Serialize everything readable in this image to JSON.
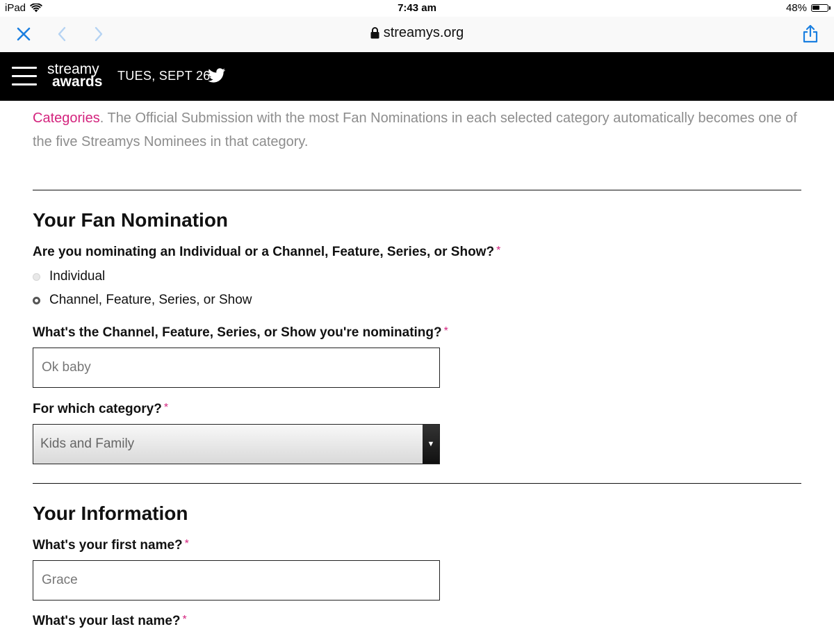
{
  "status_bar": {
    "device": "iPad",
    "time": "7:43 am",
    "battery": "48%",
    "battery_level": 0.48
  },
  "browser": {
    "url": "streamys.org",
    "icons": [
      "close-icon",
      "back-icon",
      "forward-icon",
      "lock-icon",
      "share-icon"
    ]
  },
  "site_header": {
    "logo_top": "streamy",
    "logo_bottom": "awards",
    "date": "TUES, SEPT 26"
  },
  "intro": {
    "link": "Categories",
    "text": ". The Official Submission with the most Fan Nominations in each selected category automatically becomes one of the five Streamys Nominees in that category."
  },
  "nomination": {
    "heading": "Your Fan Nomination",
    "type_question": "Are you nominating an Individual or a Channel, Feature, Series, or Show?",
    "required_mark": "*",
    "options": [
      {
        "label": "Individual",
        "selected": false
      },
      {
        "label": "Channel, Feature, Series, or Show",
        "selected": true
      }
    ],
    "name_question": "What's the Channel, Feature, Series, or Show you're nominating?",
    "name_value": "Ok baby",
    "category_question": "For which category?",
    "category_value": "Kids and Family"
  },
  "info": {
    "heading": "Your Information",
    "first_name_question": "What's your first name?",
    "first_name_value": "Grace",
    "last_name_question": "What's your last name?"
  },
  "colors": {
    "accent": "#d4247e",
    "ios_blue": "#1b7fe0",
    "header_bg": "#000000"
  }
}
